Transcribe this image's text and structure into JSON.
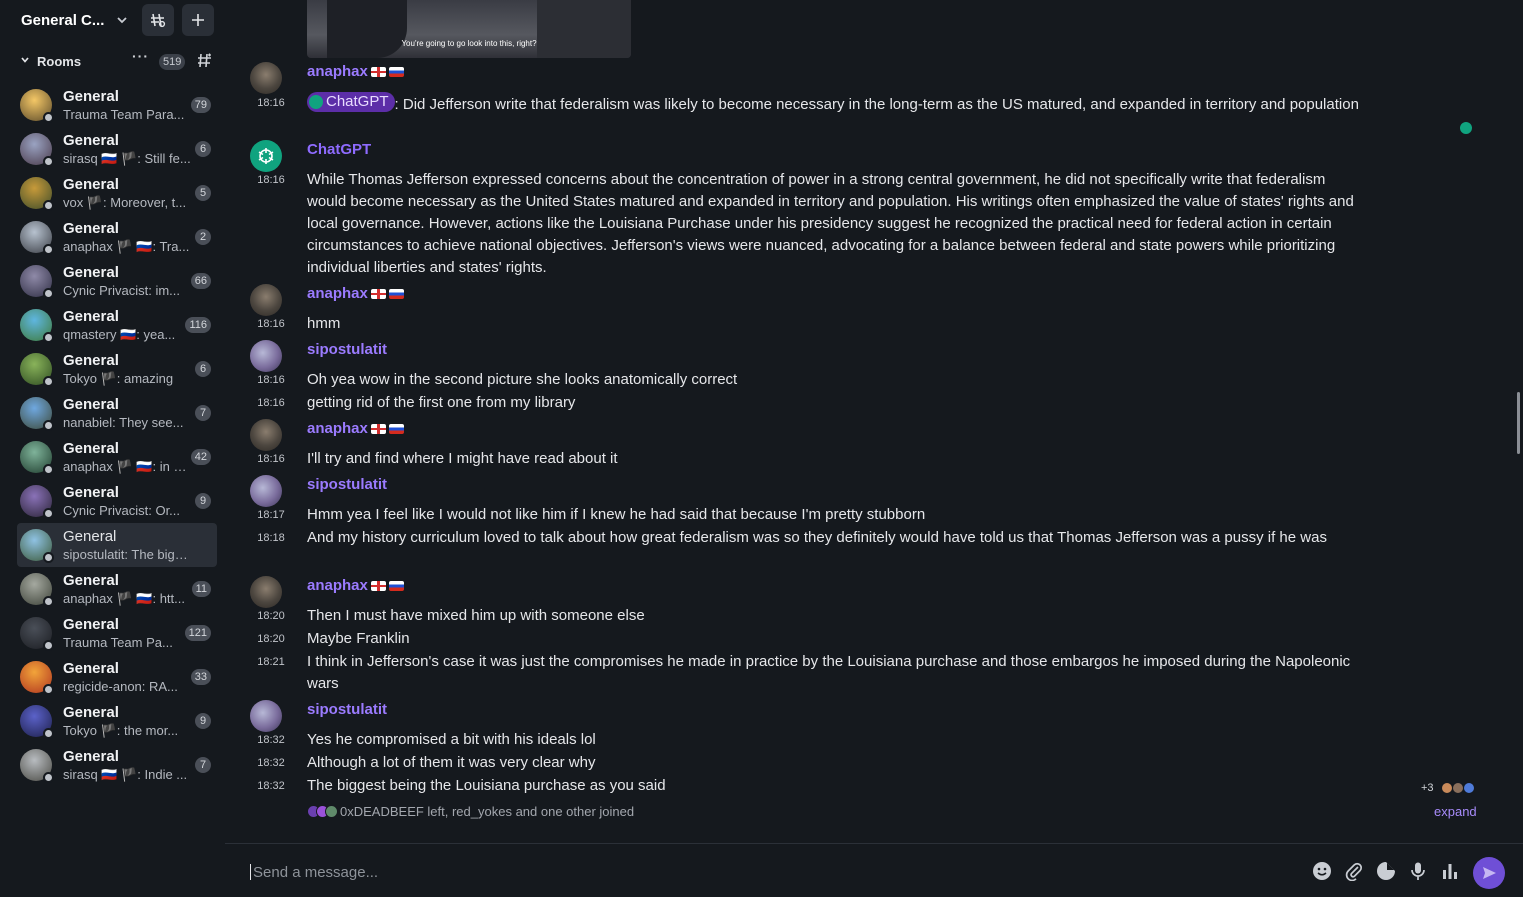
{
  "space": {
    "title": "General C..."
  },
  "rooms_section": {
    "label": "Rooms",
    "count": "519",
    "more": "···"
  },
  "rooms": [
    {
      "name": "General",
      "preview": "Trauma Team Para...",
      "badge": "79",
      "c1": "#f4c766",
      "c2": "#5b4a2a"
    },
    {
      "name": "General",
      "preview": "sirasq 🇷🇺 🏴: Still fe...",
      "badge": "6",
      "c1": "#9aa3c2",
      "c2": "#4a3a4a"
    },
    {
      "name": "General",
      "preview": "vox 🏴: Moreover, t...",
      "badge": "5",
      "c1": "#c79a3a",
      "c2": "#3f4d2a"
    },
    {
      "name": "General",
      "preview": "anaphax 🏴 🇷🇺: Tra...",
      "badge": "2",
      "c1": "#b7c2cf",
      "c2": "#3a3d44"
    },
    {
      "name": "General",
      "preview": "Cynic Privacist: im...",
      "badge": "66",
      "c1": "#8f8aa8",
      "c2": "#2f2e44"
    },
    {
      "name": "General",
      "preview": "qmastery 🇷🇺: yea...",
      "badge": "116",
      "c1": "#5fb6e0",
      "c2": "#3e7a3a"
    },
    {
      "name": "General",
      "preview": "Tokyo 🏴: amazing",
      "badge": "6",
      "c1": "#89b35a",
      "c2": "#2f4d22"
    },
    {
      "name": "General",
      "preview": "nanabiel: They see...",
      "badge": "7",
      "c1": "#6fa8e0",
      "c2": "#3d4a3a"
    },
    {
      "name": "General",
      "preview": "anaphax 🏴 🇷🇺: in a...",
      "badge": "42",
      "c1": "#7fb39a",
      "c2": "#1f3d2e"
    },
    {
      "name": "General",
      "preview": "Cynic Privacist: Or...",
      "badge": "9",
      "c1": "#8a72b8",
      "c2": "#2a2336"
    },
    {
      "name": "General",
      "preview": "sipostulatit: The bigg...",
      "badge": "",
      "c1": "#8fc2e3",
      "c2": "#3c5a3a"
    },
    {
      "name": "General",
      "preview": "anaphax 🏴 🇷🇺: htt...",
      "badge": "11",
      "c1": "#a5a9a0",
      "c2": "#3d4238"
    },
    {
      "name": "General",
      "preview": "Trauma Team Pa...",
      "badge": "121",
      "c1": "#4a4f58",
      "c2": "#1b1d22"
    },
    {
      "name": "General",
      "preview": "regicide-anon: RA...",
      "badge": "33",
      "c1": "#f2a43a",
      "c2": "#b0341f"
    },
    {
      "name": "General",
      "preview": "Tokyo 🏴: the mor...",
      "badge": "9",
      "c1": "#5b62c9",
      "c2": "#1d1f4a"
    },
    {
      "name": "General",
      "preview": "sirasq 🇷🇺 🏴: Indie ...",
      "badge": "7",
      "c1": "#b8bcc0",
      "c2": "#4a4a44"
    }
  ],
  "timeline": {
    "image_caption": "You're going to go look into this, right?",
    "blocks": [
      {
        "sender": "anaphax",
        "flags": [
          "en",
          "ru"
        ],
        "avatar": "anaphax",
        "lines": [
          {
            "time": "18:16",
            "mention": "ChatGPT",
            "text": ": Did Jefferson write that federalism was likely to become necessary in the long-term as the US matured, and expanded in territory and population"
          }
        ]
      },
      {
        "sender": "ChatGPT",
        "flags": [],
        "avatar": "gpt",
        "lines": [
          {
            "time": "18:16",
            "text": "While Thomas Jefferson expressed concerns about the concentration of power in a strong central government, he did not specifically write that federalism would become necessary as the United States matured and expanded in territory and population. His writings often emphasized the value of states' rights and local governance. However, actions like the Louisiana Purchase under his presidency suggest he recognized the practical need for federal action in certain circumstances to achieve national objectives. Jefferson's views were nuanced, advocating for a balance between federal and state powers while prioritizing individual liberties and states' rights."
          }
        ]
      },
      {
        "sender": "anaphax",
        "flags": [
          "en",
          "ru"
        ],
        "avatar": "anaphax",
        "lines": [
          {
            "time": "18:16",
            "text": "hmm"
          }
        ]
      },
      {
        "sender": "sipostulatit",
        "flags": [],
        "avatar": "sipo",
        "lines": [
          {
            "time": "18:16",
            "text": "Oh yea wow in the second picture she looks anatomically correct"
          },
          {
            "time": "18:16",
            "text": "getting rid of the first one from my library"
          }
        ]
      },
      {
        "sender": "anaphax",
        "flags": [
          "en",
          "ru"
        ],
        "avatar": "anaphax",
        "lines": [
          {
            "time": "18:16",
            "text": "I'll try and find where I might have read about it"
          }
        ]
      },
      {
        "sender": "sipostulatit",
        "flags": [],
        "avatar": "sipo",
        "lines": [
          {
            "time": "18:17",
            "text": "Hmm yea I feel like I would not like him if I knew he had said that because I'm pretty stubborn"
          },
          {
            "time": "18:18",
            "text": "And my history curriculum loved to talk about how great federalism was so they definitely would have told us that Thomas Jefferson was a pussy if he was"
          }
        ]
      },
      {
        "sender": "anaphax",
        "flags": [
          "en",
          "ru"
        ],
        "avatar": "anaphax",
        "lines": [
          {
            "time": "18:20",
            "text": "Then I must have mixed him up with someone else"
          },
          {
            "time": "18:20",
            "text": "Maybe Franklin"
          },
          {
            "time": "18:21",
            "text": "I think in Jefferson's case it was just the compromises he made in practice by the Louisiana purchase and those embargos he imposed during the Napoleonic wars"
          }
        ]
      },
      {
        "sender": "sipostulatit",
        "flags": [],
        "avatar": "sipo",
        "lines": [
          {
            "time": "18:32",
            "text": "Yes he compromised a bit with his ideals lol"
          },
          {
            "time": "18:32",
            "text": "Although a lot of them it was very clear why"
          },
          {
            "time": "18:32",
            "text": "The biggest being the Louisiana purchase as you said"
          }
        ]
      }
    ],
    "receipts_more": "+3",
    "membership": "0xDEADBEEF left, red_yokes and one other joined",
    "expand_label": "expand"
  },
  "composer": {
    "placeholder": "Send a message..."
  },
  "colors": {
    "accent": "#6f4fd6",
    "sender": "#9b7bff",
    "mention_bg": "#5c2ea8",
    "gpt": "#10a37f"
  }
}
